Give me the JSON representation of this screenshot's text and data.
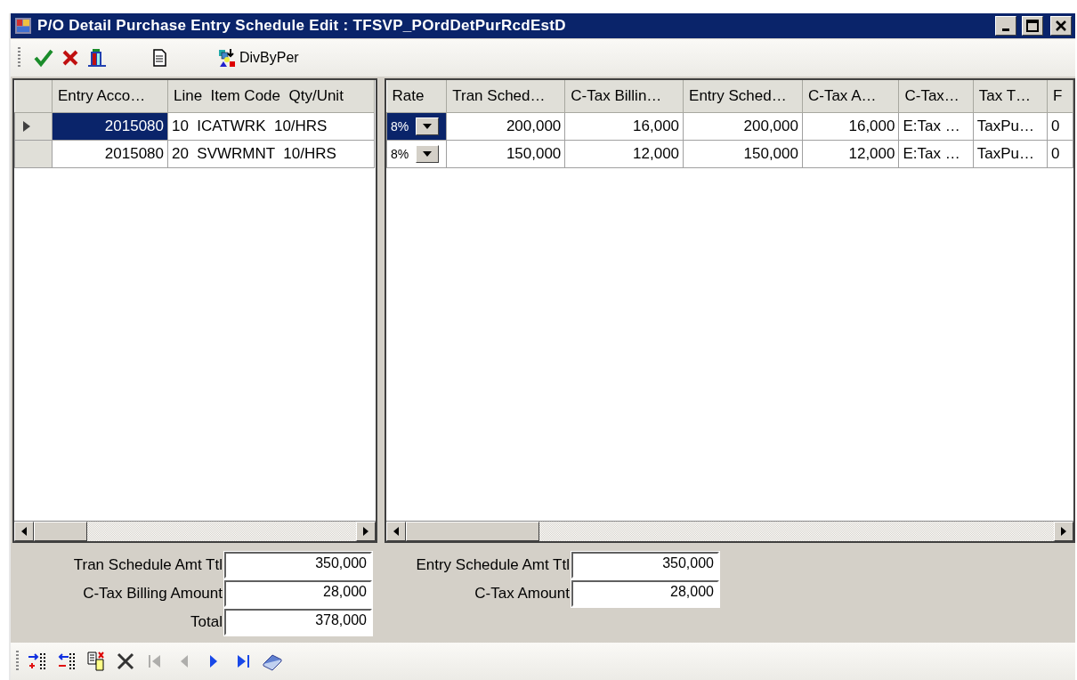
{
  "window": {
    "title": "P/O Detail Purchase Entry Schedule Edit : TFSVP_POrdDetPurRcdEstD"
  },
  "toolbar": [
    {
      "kind": "confirm"
    },
    {
      "kind": "cancel"
    },
    {
      "kind": "tool"
    },
    {
      "kind": "document"
    },
    {
      "kind": "divide",
      "label": "DivByPer"
    }
  ],
  "left_grid": {
    "columns": [
      {
        "label": "Entry Acco…",
        "kind": "number"
      },
      {
        "label": "Line  Item Code  Qty/Unit",
        "kind": "text"
      }
    ],
    "rows": [
      {
        "selected": true,
        "cells": [
          "2015080",
          "10  ICATWRK  10/HRS"
        ]
      },
      {
        "selected": false,
        "cells": [
          "2015080",
          "20  SVWRMNT  10/HRS"
        ]
      }
    ]
  },
  "right_grid": {
    "columns": [
      {
        "label": "Rate",
        "kind": "combo"
      },
      {
        "label": "Tran Sched…",
        "kind": "number"
      },
      {
        "label": "C-Tax Billin…",
        "kind": "number"
      },
      {
        "label": "Entry Sched…",
        "kind": "number"
      },
      {
        "label": "C-Tax A…",
        "kind": "number"
      },
      {
        "label": "C-Tax…",
        "kind": "text"
      },
      {
        "label": "Tax T…",
        "kind": "text"
      },
      {
        "label": "F",
        "kind": "text"
      }
    ],
    "rows": [
      {
        "selected": true,
        "cells": [
          "8%",
          "200,000",
          "16,000",
          "200,000",
          "16,000",
          "E:Tax …",
          "TaxPu…",
          "0"
        ]
      },
      {
        "selected": false,
        "cells": [
          "8%",
          "150,000",
          "12,000",
          "150,000",
          "12,000",
          "E:Tax …",
          "TaxPu…",
          "0"
        ]
      }
    ]
  },
  "totals_left": [
    {
      "label": "Tran Schedule Amt Ttl",
      "value": "350,000"
    },
    {
      "label": "C-Tax Billing Amount",
      "value": "28,000"
    },
    {
      "label": "Total",
      "value": "378,000"
    }
  ],
  "totals_right": [
    {
      "label": "Entry Schedule Amt Ttl",
      "value": "350,000"
    },
    {
      "label": "C-Tax Amount",
      "value": "28,000"
    }
  ],
  "nav_toolbar": [
    {
      "kind": "add-row",
      "disabled": false
    },
    {
      "kind": "remove-row",
      "disabled": false
    },
    {
      "kind": "copy",
      "disabled": false
    },
    {
      "kind": "delete",
      "disabled": false
    },
    {
      "kind": "first",
      "disabled": true
    },
    {
      "kind": "prev",
      "disabled": true
    },
    {
      "kind": "next",
      "disabled": false
    },
    {
      "kind": "last",
      "disabled": false
    },
    {
      "kind": "book",
      "disabled": false
    }
  ]
}
